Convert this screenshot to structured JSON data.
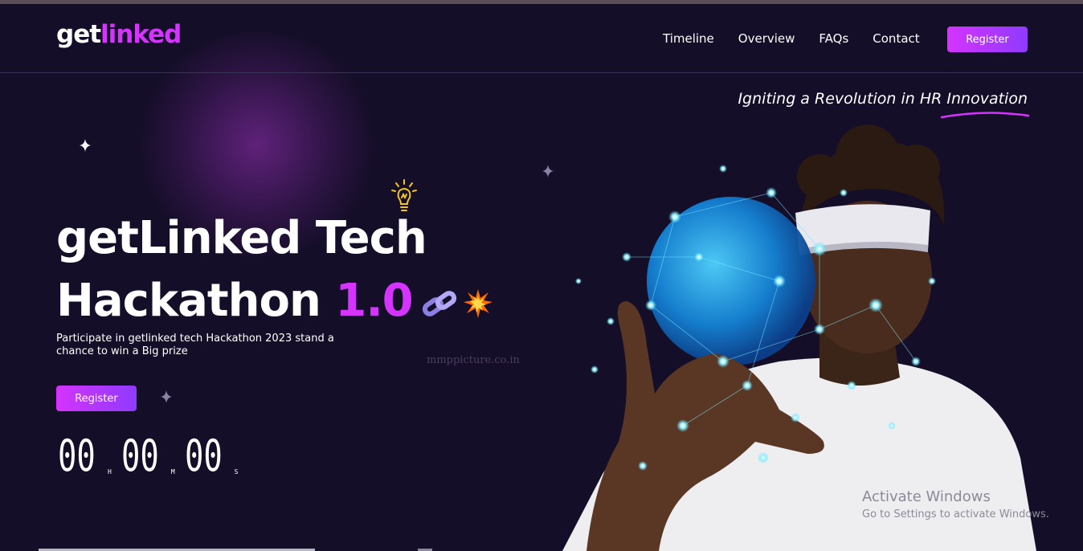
{
  "nav": {
    "logo_main": "get",
    "logo_accent": "linked",
    "links": [
      "Timeline",
      "Overview",
      "FAQs",
      "Contact"
    ],
    "register_label": "Register"
  },
  "hero": {
    "tagline": "Igniting a Revolution in HR Innovation",
    "title_line1": "getLinked Tech",
    "title_line2": "Hackathon",
    "title_version": "1.0",
    "description": "Participate in getlinked tech Hackathon 2023 stand a chance to win a Big prize",
    "register_label": "Register",
    "countdown": [
      {
        "value": "00",
        "unit": "H"
      },
      {
        "value": "00",
        "unit": "M"
      },
      {
        "value": "00",
        "unit": "S"
      }
    ],
    "watermark": "mmppicture.co.in"
  },
  "overlay": {
    "activate_title": "Activate Windows",
    "activate_sub": "Go to Settings to activate Windows."
  },
  "colors": {
    "background": "#150e28",
    "accent_pink": "#d434fe",
    "accent_purple": "#903aff"
  },
  "icons": [
    "lightbulb-icon",
    "chain-link-icon",
    "collision-icon",
    "sparkle-star-icon"
  ]
}
